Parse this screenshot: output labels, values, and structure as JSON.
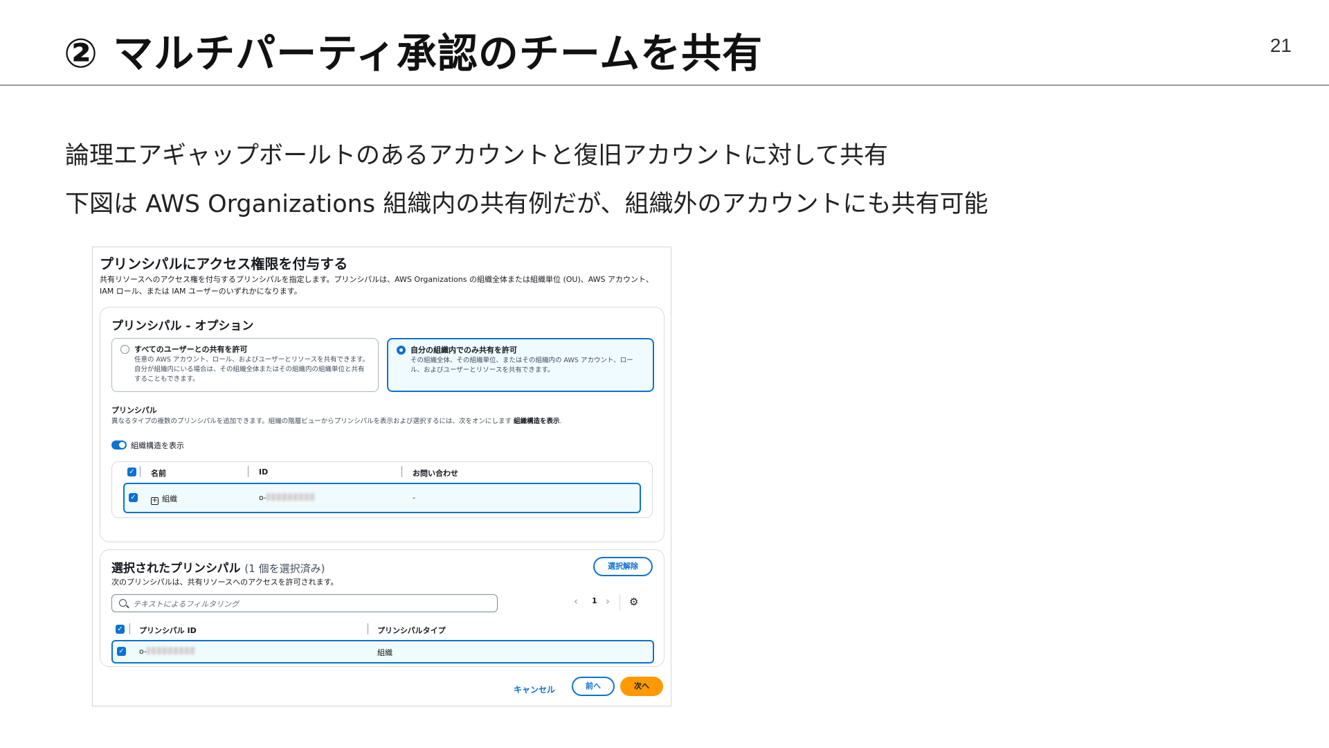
{
  "slide": {
    "title": "② マルチパーティ承認のチームを共有",
    "page_number": "21",
    "line1": "論理エアギャップボールトのあるアカウントと復旧アカウントに対して共有",
    "line2": "下図は AWS Organizations 組織内の共有例だが、組織外のアカウントにも共有可能"
  },
  "screenshot": {
    "heading": "プリンシパルにアクセス権限を付与する",
    "description": "共有リソースへのアクセス権を付与するプリンシパルを指定します。プリンシパルは、AWS Organizations の組織全体または組織単位 (OU)、AWS アカウント、IAM ロール、または IAM ユーザーのいずれかになります。",
    "options_card": {
      "title": "プリンシパル - オプション",
      "option_all": {
        "label": "すべてのユーザーとの共有を許可",
        "description": "任意の AWS アカウント、ロール、およびユーザーとリソースを共有できます。自分が組織内にいる場合は、その組織全体またはその組織内の組織単位と共有することもできます。"
      },
      "option_org": {
        "label": "自分の組織内でのみ共有を許可",
        "description": "その組織全体、その組織単位、またはその組織内の AWS アカウント、ロール、およびユーザーとリソースを共有できます。"
      },
      "principal_label": "プリンシパル",
      "principal_desc": "異なるタイプの複数のプリンシパルを追加できます。組織の階層ビューからプリンシパルを表示および選択するには、次をオンにします",
      "principal_desc_bold": "組織構造を表示",
      "toggle_label": "組織構造を表示",
      "table": {
        "headers": [
          "名前",
          "ID",
          "お問い合わせ"
        ],
        "row": {
          "name": "組織",
          "id_prefix": "o-",
          "contact": "-"
        }
      }
    },
    "selected_card": {
      "title": "選択されたプリンシパル",
      "count": "(1 個を選択済み)",
      "description": "次のプリンシパルは、共有リソースへのアクセスを許可されます。",
      "clear_button": "選択解除",
      "search_placeholder": "テキストによるフィルタリング",
      "page": "1",
      "headers": [
        "プリンシパル ID",
        "プリンシパルタイプ"
      ],
      "row": {
        "id_prefix": "o-",
        "type": "組織"
      }
    },
    "footer": {
      "cancel": "キャンセル",
      "prev": "前へ",
      "next": "次へ"
    }
  }
}
